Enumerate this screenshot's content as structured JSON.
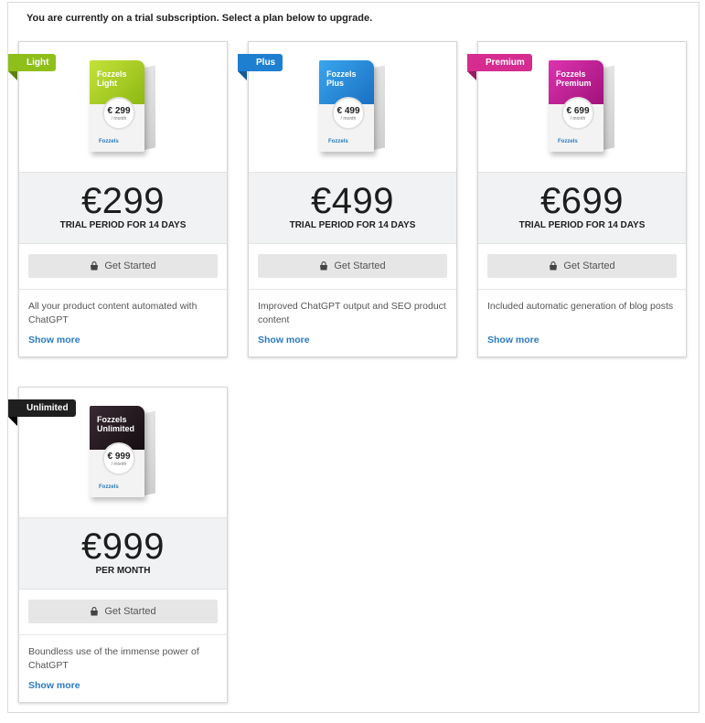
{
  "notice": "You are currently on a trial subscription. Select a plan below to upgrade.",
  "plans": [
    {
      "ribbon": "Light",
      "ribbon_color": "#8fbf1a",
      "box_name_line1": "Fozzels",
      "box_name_line2": "Light",
      "box_price": "€ 299",
      "box_per": "/ month",
      "box_brand": "Fozzels",
      "price": "€299",
      "period": "TRIAL PERIOD FOR 14 DAYS",
      "button": "Get Started",
      "description": "All your product content automated with ChatGPT",
      "show_more": "Show more"
    },
    {
      "ribbon": "Plus",
      "ribbon_color": "#1e7fd1",
      "box_name_line1": "Fozzels",
      "box_name_line2": "Plus",
      "box_price": "€ 499",
      "box_per": "/ month",
      "box_brand": "Fozzels",
      "price": "€499",
      "period": "TRIAL PERIOD FOR 14 DAYS",
      "button": "Get Started",
      "description": "Improved ChatGPT output and SEO product content",
      "show_more": "Show more"
    },
    {
      "ribbon": "Premium",
      "ribbon_color": "#d62b8f",
      "box_name_line1": "Fozzels",
      "box_name_line2": "Premium",
      "box_price": "€ 699",
      "box_per": "/ month",
      "box_brand": "Fozzels",
      "price": "€699",
      "period": "TRIAL PERIOD FOR 14 DAYS",
      "button": "Get Started",
      "description": "Included automatic generation of blog posts",
      "show_more": "Show more"
    },
    {
      "ribbon": "Unlimited",
      "ribbon_color": "#1f1f1f",
      "box_name_line1": "Fozzels",
      "box_name_line2": "Unlimited",
      "box_price": "€ 999",
      "box_per": "/ month",
      "box_brand": "Fozzels",
      "price": "€999",
      "period": "PER MONTH",
      "button": "Get Started",
      "description": "Boundless use of the immense power of ChatGPT",
      "show_more": "Show more"
    }
  ],
  "box_colors": [
    "#a9cf1c",
    "#1f86d8",
    "#c41e8f",
    "#2a1e24"
  ]
}
